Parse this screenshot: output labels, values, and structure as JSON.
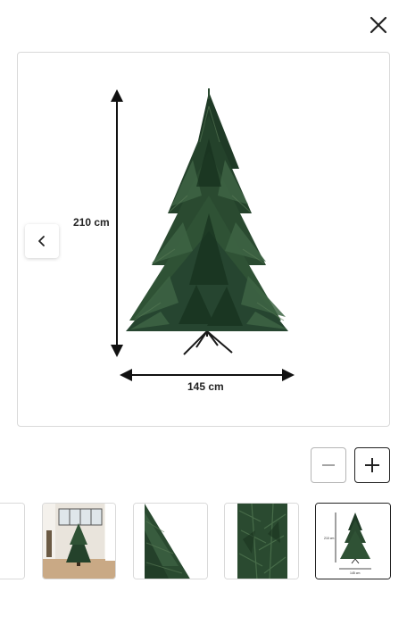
{
  "close": {
    "icon": "close-icon"
  },
  "viewer": {
    "height_label": "210 cm",
    "width_label": "145 cm",
    "prev_icon": "chevron-left-icon"
  },
  "zoom": {
    "out_icon": "minus-icon",
    "in_icon": "plus-icon"
  },
  "thumbnails": [
    {
      "name": "partial",
      "active": false
    },
    {
      "name": "room-scene",
      "active": false
    },
    {
      "name": "branch-closeup",
      "active": false
    },
    {
      "name": "needles-detail",
      "active": false
    },
    {
      "name": "dimensions",
      "active": true,
      "height_label": "210 cm",
      "width_label": "145 cm"
    }
  ],
  "colors": {
    "tree_dark": "#1f3a26",
    "tree_mid": "#2f5235",
    "tree_light": "#4a6e4a",
    "border": "#d9d9d9",
    "text": "#222222"
  }
}
